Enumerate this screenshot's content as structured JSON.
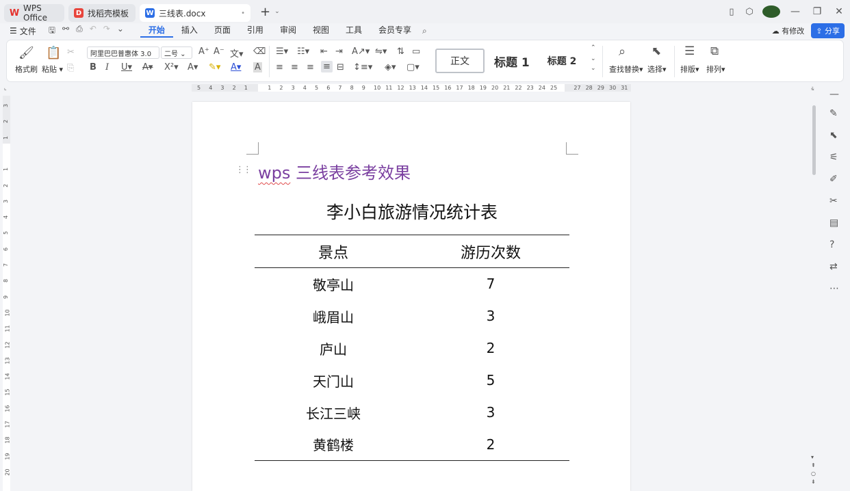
{
  "titlebar": {
    "tabs": [
      {
        "label": "WPS Office",
        "icon": "wps-logo-icon"
      },
      {
        "label": "找稻壳模板",
        "icon": "docer-logo-icon"
      },
      {
        "label": "三线表.docx",
        "icon": "word-doc-icon",
        "modified_dot": "•"
      }
    ],
    "new_tab": "+",
    "new_tab_caret": "⌄"
  },
  "menubar": {
    "file_label": "文件",
    "tabs": [
      "开始",
      "插入",
      "页面",
      "引用",
      "审阅",
      "视图",
      "工具",
      "会员专享"
    ],
    "active_tab": "开始",
    "edit_status": "有修改",
    "share_label": "分享"
  },
  "ribbon": {
    "format_painter": "格式刷",
    "paste": "粘贴",
    "font_name": "阿里巴巴普惠体 3.0",
    "font_size": "二号",
    "style_normal": "正文",
    "style_h1": "标题 1",
    "style_h2": "标题 2",
    "find_replace": "查找替换",
    "select": "选择",
    "layout": "排版",
    "arrange": "排列"
  },
  "ruler": {
    "horizontal_ticks": [
      "5",
      "4",
      "3",
      "2",
      "1",
      "",
      "1",
      "2",
      "3",
      "4",
      "5",
      "6",
      "7",
      "8",
      "9",
      "10",
      "11",
      "12",
      "13",
      "14",
      "15",
      "16",
      "17",
      "18",
      "19",
      "20",
      "21",
      "22",
      "23",
      "24",
      "25",
      "",
      "27",
      "28",
      "29",
      "30",
      "31"
    ],
    "vertical_ticks": [
      "3",
      "2",
      "1",
      "",
      "1",
      "2",
      "3",
      "4",
      "5",
      "6",
      "7",
      "8",
      "9",
      "10",
      "11",
      "12",
      "13",
      "14",
      "15",
      "16",
      "17",
      "18",
      "19",
      "20"
    ]
  },
  "document": {
    "heading": "wps 三线表参考效果",
    "heading_squiggle": "wps",
    "heading_rest": " 三线表参考效果",
    "table_title": "李小白旅游情况统计表",
    "table": {
      "headers": [
        "景点",
        "游历次数"
      ],
      "rows": [
        [
          "敬亭山",
          "7"
        ],
        [
          "峨眉山",
          "3"
        ],
        [
          "庐山",
          "2"
        ],
        [
          "天门山",
          "5"
        ],
        [
          "长江三峡",
          "3"
        ],
        [
          "黄鹤楼",
          "2"
        ]
      ]
    }
  },
  "colors": {
    "accent": "#2c6ee6",
    "heading": "#7a3fa0"
  }
}
